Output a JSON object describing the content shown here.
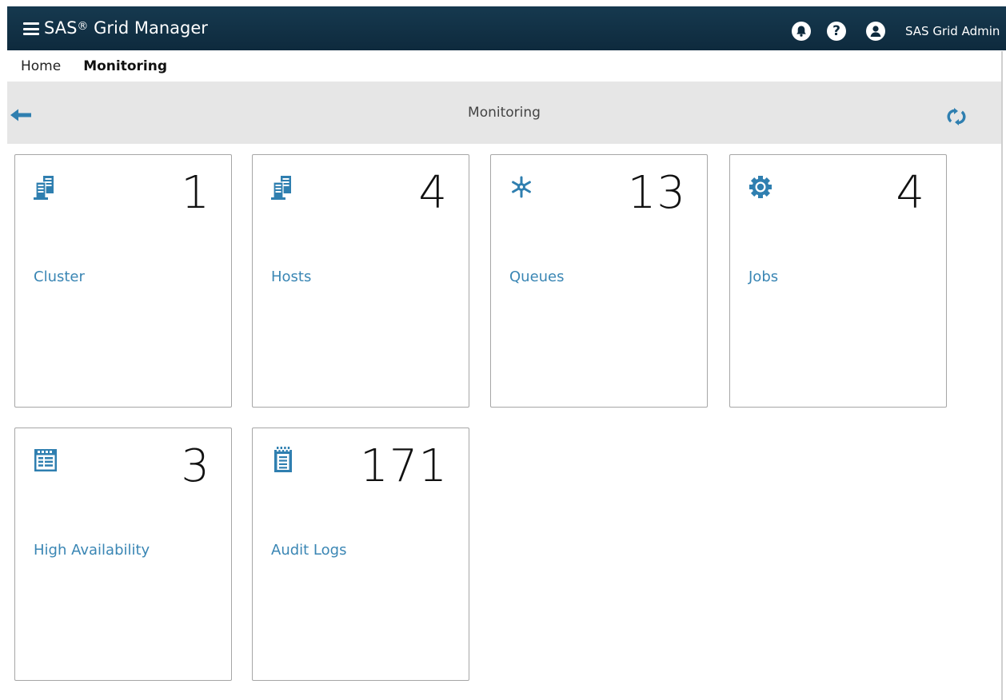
{
  "app": {
    "title": "SAS® Grid Manager",
    "title_main": "SAS",
    "title_reg": "®",
    "title_rest": " Grid Manager",
    "user_name": "SAS Grid Admin"
  },
  "topbar_icons": [
    "menu-icon",
    "bell-icon",
    "help-icon",
    "user-icon"
  ],
  "breadcrumbs": [
    {
      "label": "Home",
      "active": false
    },
    {
      "label": "Monitoring",
      "active": true
    }
  ],
  "header": {
    "title": "Monitoring",
    "back_icon": "arrow-left-icon",
    "refresh_icon": "refresh-icon"
  },
  "tiles": [
    {
      "label": "Cluster",
      "count": "1",
      "icon": "server-icon"
    },
    {
      "label": "Hosts",
      "count": "4",
      "icon": "server-icon"
    },
    {
      "label": "Queues",
      "count": "13",
      "icon": "queue-icon"
    },
    {
      "label": "Jobs",
      "count": "4",
      "icon": "gear-icon"
    },
    {
      "label": "High Availability",
      "count": "3",
      "icon": "calendar-icon"
    },
    {
      "label": "Audit Logs",
      "count": "171",
      "icon": "notepad-icon"
    }
  ],
  "colors": {
    "topbar": "#0e2a3d",
    "accent": "#3a86b4",
    "icon_blue": "#2f7fb0",
    "header_bar": "#e6e6e6"
  }
}
